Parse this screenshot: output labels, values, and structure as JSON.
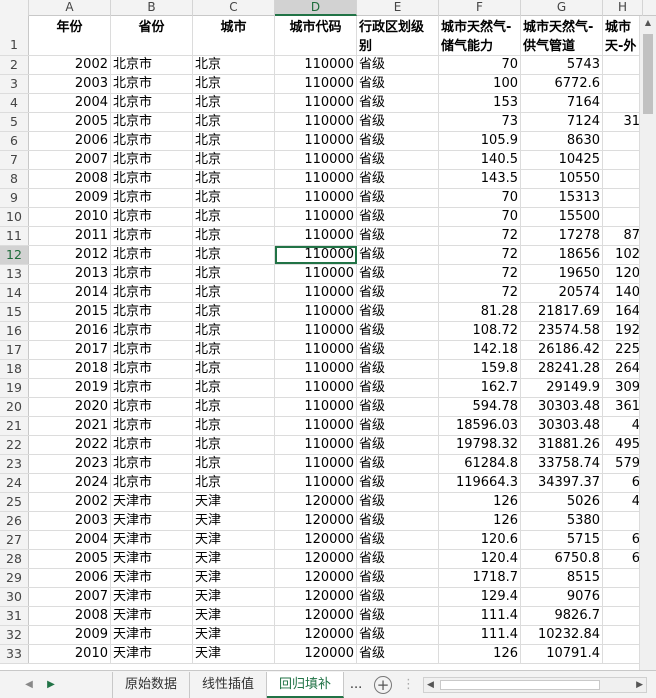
{
  "columns": [
    "A",
    "B",
    "C",
    "D",
    "E",
    "F",
    "G",
    "H"
  ],
  "selected_column": "D",
  "selected_row": 12,
  "headers": [
    "年份",
    "省份",
    "城市",
    "城市代码",
    "行政区划级别",
    "城市天然气-储气能力",
    "城市天然气-供气管道",
    "城市天-外"
  ],
  "rows": [
    {
      "n": 2,
      "c": [
        "2002",
        "北京市",
        "北京",
        "110000",
        "省级",
        "70",
        "5743",
        ""
      ]
    },
    {
      "n": 3,
      "c": [
        "2003",
        "北京市",
        "北京",
        "110000",
        "省级",
        "100",
        "6772.6",
        ""
      ]
    },
    {
      "n": 4,
      "c": [
        "2004",
        "北京市",
        "北京",
        "110000",
        "省级",
        "153",
        "7164",
        ""
      ]
    },
    {
      "n": 5,
      "c": [
        "2005",
        "北京市",
        "北京",
        "110000",
        "省级",
        "73",
        "7124",
        "31"
      ]
    },
    {
      "n": 6,
      "c": [
        "2006",
        "北京市",
        "北京",
        "110000",
        "省级",
        "105.9",
        "8630",
        ""
      ]
    },
    {
      "n": 7,
      "c": [
        "2007",
        "北京市",
        "北京",
        "110000",
        "省级",
        "140.5",
        "10425",
        ""
      ]
    },
    {
      "n": 8,
      "c": [
        "2008",
        "北京市",
        "北京",
        "110000",
        "省级",
        "143.5",
        "10550",
        ""
      ]
    },
    {
      "n": 9,
      "c": [
        "2009",
        "北京市",
        "北京",
        "110000",
        "省级",
        "70",
        "15313",
        ""
      ]
    },
    {
      "n": 10,
      "c": [
        "2010",
        "北京市",
        "北京",
        "110000",
        "省级",
        "70",
        "15500",
        ""
      ]
    },
    {
      "n": 11,
      "c": [
        "2011",
        "北京市",
        "北京",
        "110000",
        "省级",
        "72",
        "17278",
        "87"
      ]
    },
    {
      "n": 12,
      "c": [
        "2012",
        "北京市",
        "北京",
        "110000",
        "省级",
        "72",
        "18656",
        "102"
      ]
    },
    {
      "n": 13,
      "c": [
        "2013",
        "北京市",
        "北京",
        "110000",
        "省级",
        "72",
        "19650",
        "120"
      ]
    },
    {
      "n": 14,
      "c": [
        "2014",
        "北京市",
        "北京",
        "110000",
        "省级",
        "72",
        "20574",
        "140"
      ]
    },
    {
      "n": 15,
      "c": [
        "2015",
        "北京市",
        "北京",
        "110000",
        "省级",
        "81.28",
        "21817.69",
        "164"
      ]
    },
    {
      "n": 16,
      "c": [
        "2016",
        "北京市",
        "北京",
        "110000",
        "省级",
        "108.72",
        "23574.58",
        "192"
      ]
    },
    {
      "n": 17,
      "c": [
        "2017",
        "北京市",
        "北京",
        "110000",
        "省级",
        "142.18",
        "26186.42",
        "225"
      ]
    },
    {
      "n": 18,
      "c": [
        "2018",
        "北京市",
        "北京",
        "110000",
        "省级",
        "159.8",
        "28241.28",
        "264"
      ]
    },
    {
      "n": 19,
      "c": [
        "2019",
        "北京市",
        "北京",
        "110000",
        "省级",
        "162.7",
        "29149.9",
        "309"
      ]
    },
    {
      "n": 20,
      "c": [
        "2020",
        "北京市",
        "北京",
        "110000",
        "省级",
        "594.78",
        "30303.48",
        "361"
      ]
    },
    {
      "n": 21,
      "c": [
        "2021",
        "北京市",
        "北京",
        "110000",
        "省级",
        "18596.03",
        "30303.48",
        "4"
      ]
    },
    {
      "n": 22,
      "c": [
        "2022",
        "北京市",
        "北京",
        "110000",
        "省级",
        "19798.32",
        "31881.26",
        "495"
      ]
    },
    {
      "n": 23,
      "c": [
        "2023",
        "北京市",
        "北京",
        "110000",
        "省级",
        "61284.8",
        "33758.74",
        "579"
      ]
    },
    {
      "n": 24,
      "c": [
        "2024",
        "北京市",
        "北京",
        "110000",
        "省级",
        "119664.3",
        "34397.37",
        "6"
      ]
    },
    {
      "n": 25,
      "c": [
        "2002",
        "天津市",
        "天津",
        "120000",
        "省级",
        "126",
        "5026",
        "4"
      ]
    },
    {
      "n": 26,
      "c": [
        "2003",
        "天津市",
        "天津",
        "120000",
        "省级",
        "126",
        "5380",
        ""
      ]
    },
    {
      "n": 27,
      "c": [
        "2004",
        "天津市",
        "天津",
        "120000",
        "省级",
        "120.6",
        "5715",
        "6"
      ]
    },
    {
      "n": 28,
      "c": [
        "2005",
        "天津市",
        "天津",
        "120000",
        "省级",
        "120.4",
        "6750.8",
        "6"
      ]
    },
    {
      "n": 29,
      "c": [
        "2006",
        "天津市",
        "天津",
        "120000",
        "省级",
        "1718.7",
        "8515",
        ""
      ]
    },
    {
      "n": 30,
      "c": [
        "2007",
        "天津市",
        "天津",
        "120000",
        "省级",
        "129.4",
        "9076",
        ""
      ]
    },
    {
      "n": 31,
      "c": [
        "2008",
        "天津市",
        "天津",
        "120000",
        "省级",
        "111.4",
        "9826.7",
        ""
      ]
    },
    {
      "n": 32,
      "c": [
        "2009",
        "天津市",
        "天津",
        "120000",
        "省级",
        "111.4",
        "10232.84",
        ""
      ]
    },
    {
      "n": 33,
      "c": [
        "2010",
        "天津市",
        "天津",
        "120000",
        "省级",
        "126",
        "10791.4",
        ""
      ]
    }
  ],
  "tabs": {
    "items": [
      {
        "label": "原始数据",
        "active": false
      },
      {
        "label": "线性插值",
        "active": false
      },
      {
        "label": "回归填补",
        "active": true
      }
    ],
    "more_label": "...",
    "add_label": "+"
  }
}
